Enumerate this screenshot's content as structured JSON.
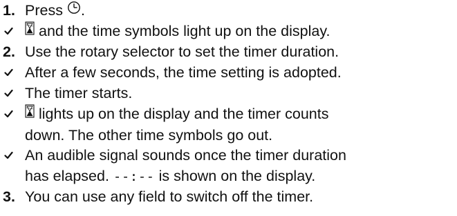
{
  "instructions": {
    "steps": [
      {
        "marker": "1.",
        "before": "Press",
        "after": "."
      },
      {
        "marker": "2.",
        "text": "Use the rotary selector to set the timer duration."
      },
      {
        "marker": "3.",
        "text": "You can use any field to switch off the timer."
      }
    ],
    "results": [
      {
        "text": "and the time symbols light up on the display."
      },
      {
        "text": "After a few seconds, the time setting is adopted."
      },
      {
        "text": "The timer starts."
      },
      {
        "line1": "lights up on the display and the timer counts",
        "line2": "down. The other time symbols go out."
      },
      {
        "line1": "An audible signal sounds once the timer duration",
        "line2_before": "has elapsed.",
        "line2_display": "--:--",
        "line2_after": "is shown on the display."
      }
    ],
    "icons": {
      "timer_button": "clock-icon",
      "timer_symbol": "hourglass-icon",
      "result_marker": "check-icon"
    }
  }
}
